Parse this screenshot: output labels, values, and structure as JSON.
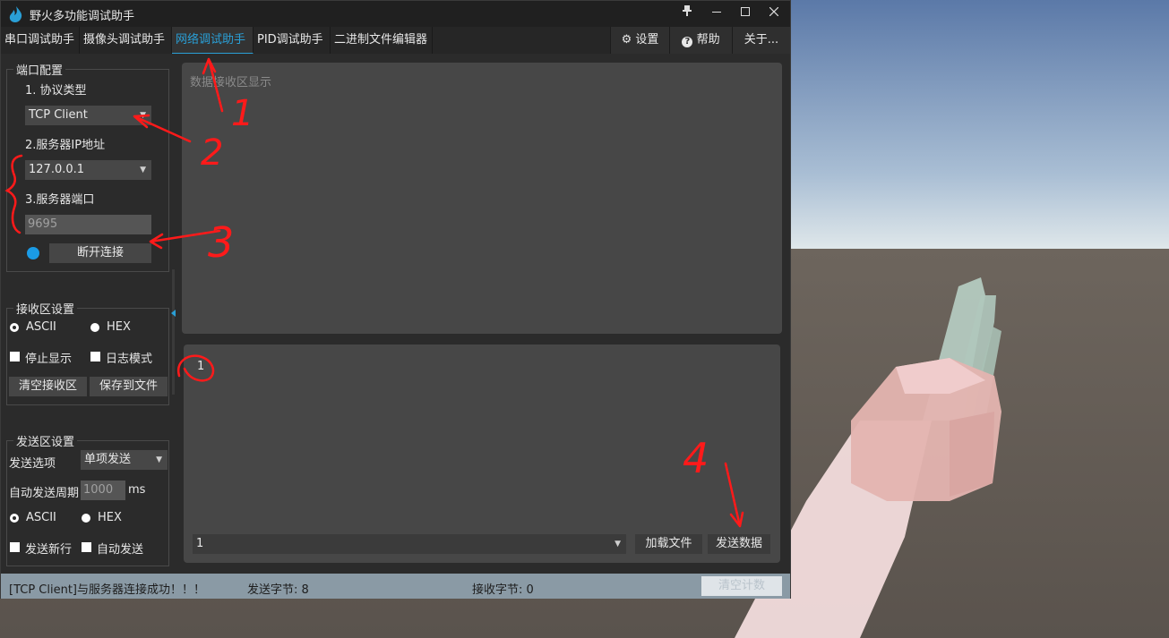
{
  "window": {
    "title": "野火多功能调试助手"
  },
  "tabs": [
    "串口调试助手",
    "摄像头调试助手",
    "网络调试助手",
    "PID调试助手",
    "二进制文件编辑器"
  ],
  "right_buttons": {
    "settings": "设置",
    "help": "帮助",
    "about": "关于..."
  },
  "port_config": {
    "title": "端口配置",
    "protocol_label": "1. 协议类型",
    "protocol_value": "TCP Client",
    "ip_label": "2.服务器IP地址",
    "ip_value": "127.0.0.1",
    "port_label": "3.服务器端口",
    "port_value": "9695",
    "disconnect_button": "断开连接",
    "status_color": "#1a9be6"
  },
  "receive_settings": {
    "title": "接收区设置",
    "ascii": "ASCII",
    "hex": "HEX",
    "stop_display": "停止显示",
    "log_mode": "日志模式",
    "clear_button": "清空接收区",
    "save_button": "保存到文件"
  },
  "send_settings": {
    "title": "发送区设置",
    "option_label": "发送选项",
    "option_value": "单项发送",
    "period_label": "自动发送周期",
    "period_value": "1000",
    "period_unit": "ms",
    "ascii": "ASCII",
    "hex": "HEX",
    "newline": "发送新行",
    "auto_send": "自动发送"
  },
  "receive_area": {
    "placeholder": "数据接收区显示"
  },
  "send_area": {
    "content": "1",
    "history_value": "1",
    "load_button": "加载文件",
    "send_button": "发送数据"
  },
  "status": {
    "message": "[TCP Client]与服务器连接成功！！！",
    "sent_bytes": "发送字节: 8",
    "recv_bytes": "接收字节: 0",
    "clear_count": "清空计数"
  },
  "annotations": [
    "1",
    "2",
    "3",
    "4"
  ],
  "colors": {
    "accent": "#2a9fd6",
    "annotation": "#ff1a1a"
  }
}
